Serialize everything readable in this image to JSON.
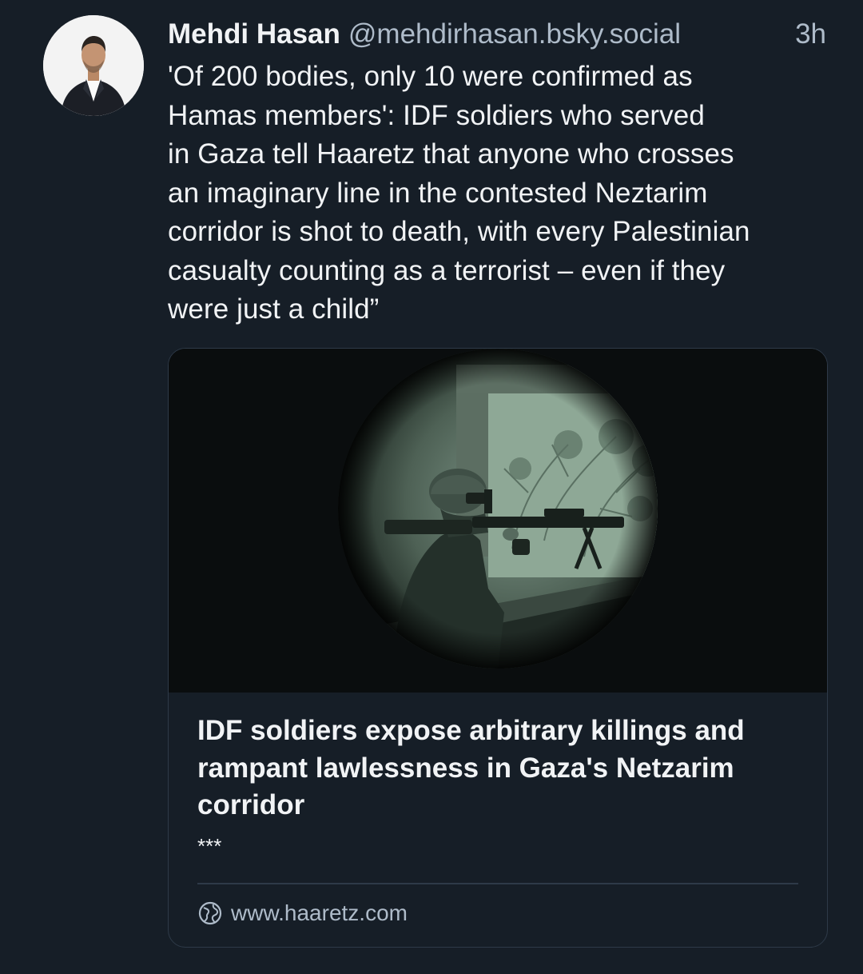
{
  "post": {
    "author": {
      "display_name": "Mehdi Hasan",
      "handle": "@mehdirhasan.bsky.social",
      "avatar_icon": "avatar-photo"
    },
    "timestamp": "3h",
    "text_lines": [
      "'Of 200 bodies, only 10 were confirmed as",
      "Hamas members': IDF soldiers who served",
      "in Gaza tell Haaretz that anyone who crosses",
      "an imaginary line in the contested Neztarim",
      "corridor is shot to death, with every Palestinian",
      "casualty counting as a terrorist – even if they",
      "were just a child”"
    ],
    "link_card": {
      "image_icon": "night-vision-photo",
      "title_lines": [
        "IDF soldiers expose arbitrary killings and",
        "rampant lawlessness in Gaza's Netzarim",
        "corridor"
      ],
      "description": "***",
      "domain_icon": "globe-icon",
      "domain": "www.haaretz.com"
    }
  },
  "colors": {
    "background": "#161e27",
    "text_primary": "#f1f3f5",
    "text_secondary": "#aebbc9",
    "border": "#2e3a48"
  }
}
